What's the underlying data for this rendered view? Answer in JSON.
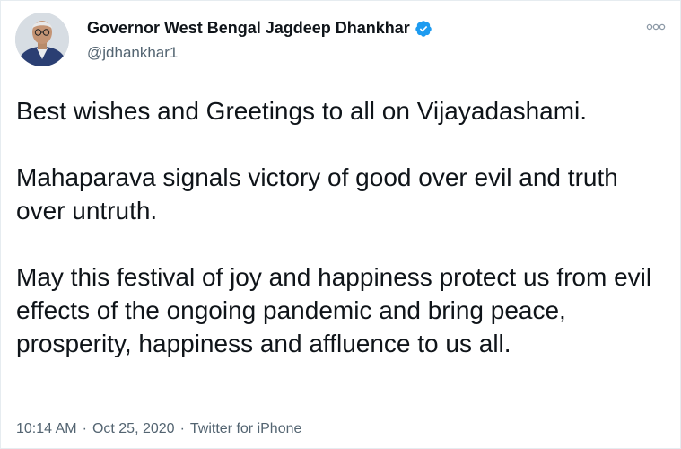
{
  "account": {
    "display_name": "Governor West Bengal Jagdeep Dhankhar",
    "handle": "@jdhankhar1",
    "verified": true,
    "verified_color": "#1d9bf0"
  },
  "tweet": {
    "paragraphs": [
      "Best wishes and Greetings to all on Vijayadashami.",
      "Mahaparava signals victory of good over evil and truth over untruth.",
      "May this festival of joy and happiness protect us from evil effects of the ongoing pandemic and bring peace, prosperity, happiness and affluence to us all."
    ]
  },
  "meta": {
    "time": "10:14 AM",
    "separator": "·",
    "date": "Oct 25, 2020",
    "source": "Twitter for iPhone"
  },
  "icons": {
    "avatar": "profile-photo",
    "verified": "verified-badge-icon",
    "more": "more-options-icon"
  }
}
